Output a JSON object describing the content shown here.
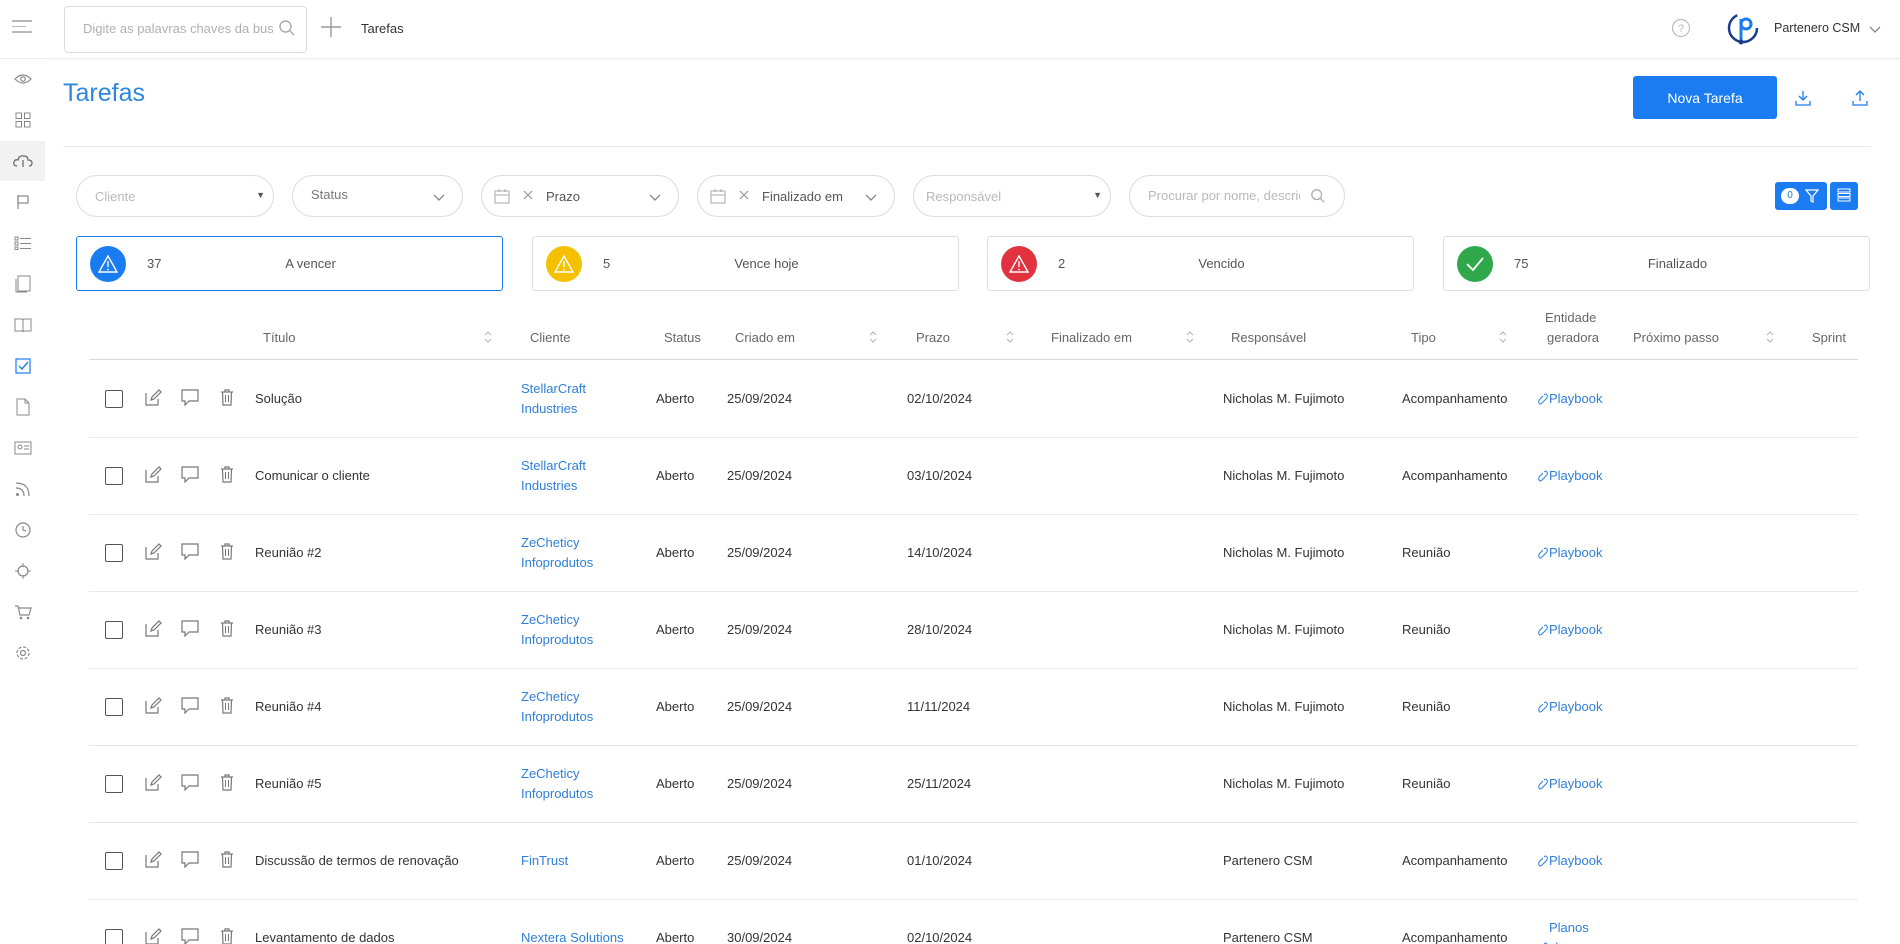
{
  "topbar": {
    "search_placeholder": "Digite as palavras chaves da busca",
    "title": "Tarefas",
    "user_name": "Partenero CSM"
  },
  "sidebar": {
    "items": [
      {
        "icon": "eye-icon"
      },
      {
        "icon": "grid-icon"
      },
      {
        "icon": "cloud-icon",
        "active": true
      },
      {
        "icon": "flag-icon"
      },
      {
        "icon": "list-icon"
      },
      {
        "icon": "book-stack-icon"
      },
      {
        "icon": "book-open-icon"
      },
      {
        "icon": "checkbox-icon"
      },
      {
        "icon": "document-icon"
      },
      {
        "icon": "id-card-icon"
      },
      {
        "icon": "rss-icon"
      },
      {
        "icon": "clock-icon"
      },
      {
        "icon": "crosshair-icon"
      },
      {
        "icon": "cart-icon"
      },
      {
        "icon": "gear-icon"
      }
    ]
  },
  "page": {
    "title": "Tarefas",
    "new_button": "Nova Tarefa"
  },
  "filters": {
    "cliente": "Cliente",
    "status": "Status",
    "prazo": "Prazo",
    "finalizado": "Finalizado em",
    "responsavel": "Responsável",
    "search_placeholder": "Procurar por nome, descrição",
    "active_count": "0"
  },
  "summary_cards": [
    {
      "count": "37",
      "label": "A vencer",
      "color": "#1a7cf0",
      "icon": "warning-icon",
      "selected": true
    },
    {
      "count": "5",
      "label": "Vence hoje",
      "color": "#f5c000",
      "icon": "warning-icon"
    },
    {
      "count": "2",
      "label": "Vencido",
      "color": "#e0333f",
      "icon": "warning-icon"
    },
    {
      "count": "75",
      "label": "Finalizado",
      "color": "#2ea84a",
      "icon": "check-icon"
    }
  ],
  "table": {
    "headers": {
      "titulo": "Título",
      "cliente": "Cliente",
      "status": "Status",
      "criado": "Criado em",
      "prazo": "Prazo",
      "finalizado": "Finalizado em",
      "responsavel": "Responsável",
      "tipo": "Tipo",
      "entidade_1": "Entidade",
      "entidade_2": "geradora",
      "proximo": "Próximo passo",
      "sprint": "Sprint"
    },
    "rows": [
      {
        "titulo": "Solução",
        "cliente_1": "StellarCraft",
        "cliente_2": "Industries",
        "status": "Aberto",
        "criado": "25/09/2024",
        "prazo": "02/10/2024",
        "responsavel": "Nicholas M. Fujimoto",
        "tipo": "Acompanhamento",
        "entidade": "Playbook"
      },
      {
        "titulo": "Comunicar o cliente",
        "cliente_1": "StellarCraft",
        "cliente_2": "Industries",
        "status": "Aberto",
        "criado": "25/09/2024",
        "prazo": "03/10/2024",
        "responsavel": "Nicholas M. Fujimoto",
        "tipo": "Acompanhamento",
        "entidade": "Playbook"
      },
      {
        "titulo": "Reunião #2",
        "cliente_1": "ZeCheticy",
        "cliente_2": "Infoprodutos",
        "status": "Aberto",
        "criado": "25/09/2024",
        "prazo": "14/10/2024",
        "responsavel": "Nicholas M. Fujimoto",
        "tipo": "Reunião",
        "entidade": "Playbook"
      },
      {
        "titulo": "Reunião #3",
        "cliente_1": "ZeCheticy",
        "cliente_2": "Infoprodutos",
        "status": "Aberto",
        "criado": "25/09/2024",
        "prazo": "28/10/2024",
        "responsavel": "Nicholas M. Fujimoto",
        "tipo": "Reunião",
        "entidade": "Playbook"
      },
      {
        "titulo": "Reunião #4",
        "cliente_1": "ZeCheticy",
        "cliente_2": "Infoprodutos",
        "status": "Aberto",
        "criado": "25/09/2024",
        "prazo": "11/11/2024",
        "responsavel": "Nicholas M. Fujimoto",
        "tipo": "Reunião",
        "entidade": "Playbook"
      },
      {
        "titulo": "Reunião #5",
        "cliente_1": "ZeCheticy",
        "cliente_2": "Infoprodutos",
        "status": "Aberto",
        "criado": "25/09/2024",
        "prazo": "25/11/2024",
        "responsavel": "Nicholas M. Fujimoto",
        "tipo": "Reunião",
        "entidade": "Playbook"
      },
      {
        "titulo": "Discussão de termos de renovação",
        "cliente_1": "FinTrust",
        "cliente_2": "",
        "status": "Aberto",
        "criado": "25/09/2024",
        "prazo": "01/10/2024",
        "responsavel": "Partenero CSM",
        "tipo": "Acompanhamento",
        "entidade": "Playbook"
      },
      {
        "titulo": "Levantamento de dados",
        "cliente_1": "Nextera Solutions",
        "cliente_2": "",
        "status": "Aberto",
        "criado": "30/09/2024",
        "prazo": "02/10/2024",
        "responsavel": "Partenero CSM",
        "tipo": "Acompanhamento",
        "entidade_1": "Planos",
        "entidade_2": "de"
      }
    ]
  }
}
